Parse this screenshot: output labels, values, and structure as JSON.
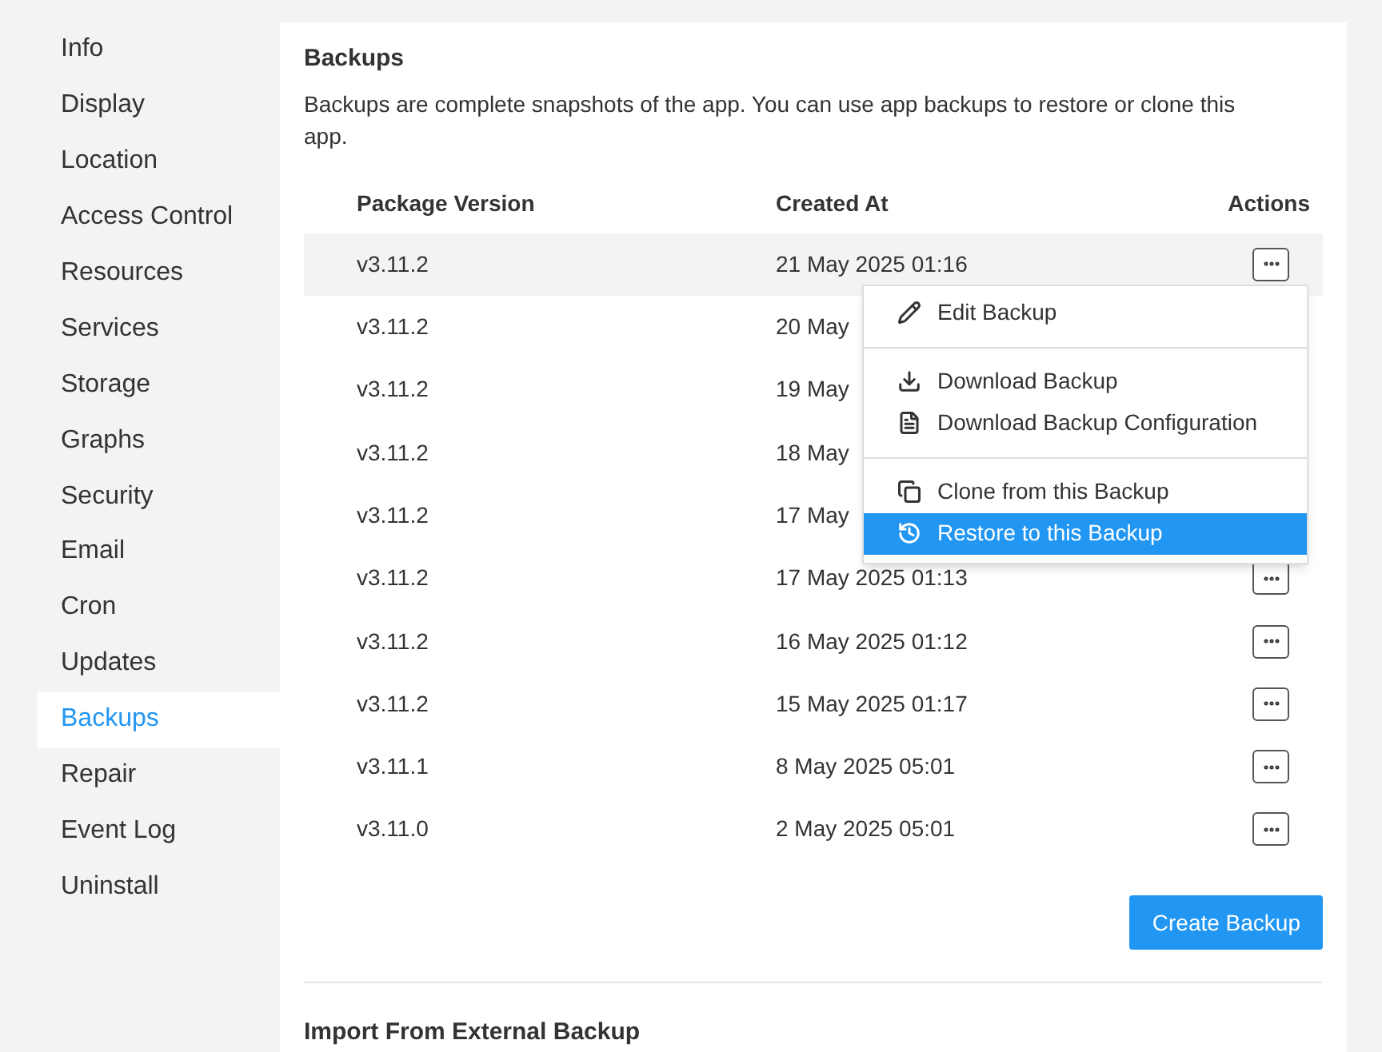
{
  "sidebar": {
    "items": [
      {
        "label": "Info",
        "selected": false
      },
      {
        "label": "Display",
        "selected": false
      },
      {
        "label": "Location",
        "selected": false
      },
      {
        "label": "Access Control",
        "selected": false
      },
      {
        "label": "Resources",
        "selected": false
      },
      {
        "label": "Services",
        "selected": false
      },
      {
        "label": "Storage",
        "selected": false
      },
      {
        "label": "Graphs",
        "selected": false
      },
      {
        "label": "Security",
        "selected": false
      },
      {
        "label": "Email",
        "selected": false
      },
      {
        "label": "Cron",
        "selected": false
      },
      {
        "label": "Updates",
        "selected": false
      },
      {
        "label": "Backups",
        "selected": true
      },
      {
        "label": "Repair",
        "selected": false
      },
      {
        "label": "Event Log",
        "selected": false
      },
      {
        "label": "Uninstall",
        "selected": false
      }
    ]
  },
  "section": {
    "title": "Backups",
    "description": "Backups are complete snapshots of the app. You can use app backups to restore or clone this app."
  },
  "table": {
    "columns": [
      "Package Version",
      "Created At",
      "Actions"
    ],
    "rows": [
      {
        "version": "v3.11.2",
        "created": "21 May 2025 01:16",
        "selected": true,
        "action_button": true
      },
      {
        "version": "v3.11.2",
        "created": "20 May",
        "selected": false,
        "action_button": false
      },
      {
        "version": "v3.11.2",
        "created": "19 May",
        "selected": false,
        "action_button": false
      },
      {
        "version": "v3.11.2",
        "created": "18 May",
        "selected": false,
        "action_button": false
      },
      {
        "version": "v3.11.2",
        "created": "17 May",
        "selected": false,
        "action_button": false
      },
      {
        "version": "v3.11.2",
        "created": "17 May 2025 01:13",
        "selected": false,
        "action_button": true
      },
      {
        "version": "v3.11.2",
        "created": "16 May 2025 01:12",
        "selected": false,
        "action_button": true
      },
      {
        "version": "v3.11.2",
        "created": "15 May 2025 01:17",
        "selected": false,
        "action_button": true
      },
      {
        "version": "v3.11.1",
        "created": "8 May 2025 05:01",
        "selected": false,
        "action_button": true
      },
      {
        "version": "v3.11.0",
        "created": "2 May 2025 05:01",
        "selected": false,
        "action_button": true
      }
    ]
  },
  "menu": {
    "groups": [
      [
        {
          "label": "Edit Backup",
          "selected": false
        }
      ],
      [
        {
          "label": "Download Backup",
          "selected": false
        },
        {
          "label": "Download Backup Configuration",
          "selected": false
        }
      ],
      [
        {
          "label": "Clone from this Backup",
          "selected": false
        },
        {
          "label": "Restore to this Backup",
          "selected": true
        }
      ]
    ]
  },
  "create_button": "Create Backup",
  "import_title": "Import From External Backup"
}
